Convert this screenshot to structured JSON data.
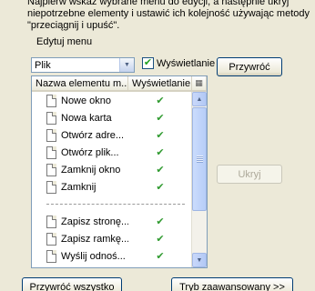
{
  "intro_text": "Najpierw wskaż wybrane menu do edycji, a następnie ukryj niepotrzebne elementy i ustawić ich kolejność używając metody \"przeciągnij i upuść\".",
  "section_label": "Edytuj menu",
  "menu_select": {
    "value": "Plik",
    "icon": "chevron-down-icon"
  },
  "show_checkbox": {
    "label": "Wyświetlanie",
    "checked": true
  },
  "buttons": {
    "restore": "Przywróć",
    "hide": "Ukryj",
    "restore_all": "Przywróć wszystko",
    "advanced": "Tryb zaawansowany >>"
  },
  "list": {
    "columns": [
      "Nazwa elementu m...",
      "Wyświetlanie"
    ],
    "rows": [
      {
        "type": "item",
        "name": "Nowe okno",
        "visible": true
      },
      {
        "type": "item",
        "name": "Nowa karta",
        "visible": true
      },
      {
        "type": "item",
        "name": "Otwórz adre...",
        "visible": true
      },
      {
        "type": "item",
        "name": "Otwórz plik...",
        "visible": true
      },
      {
        "type": "item",
        "name": "Zamknij okno",
        "visible": true
      },
      {
        "type": "item",
        "name": "Zamknij",
        "visible": true
      },
      {
        "type": "separator"
      },
      {
        "type": "item",
        "name": "Zapisz stronę...",
        "visible": true
      },
      {
        "type": "item",
        "name": "Zapisz ramkę...",
        "visible": true
      },
      {
        "type": "item",
        "name": "Wyślij odnoś...",
        "visible": true
      },
      {
        "type": "separator"
      }
    ]
  },
  "check_glyph": "✔",
  "colors": {
    "window_bg": "#ece9d8",
    "check_green": "#2f9a2f",
    "border_blue": "#7f9db9"
  }
}
